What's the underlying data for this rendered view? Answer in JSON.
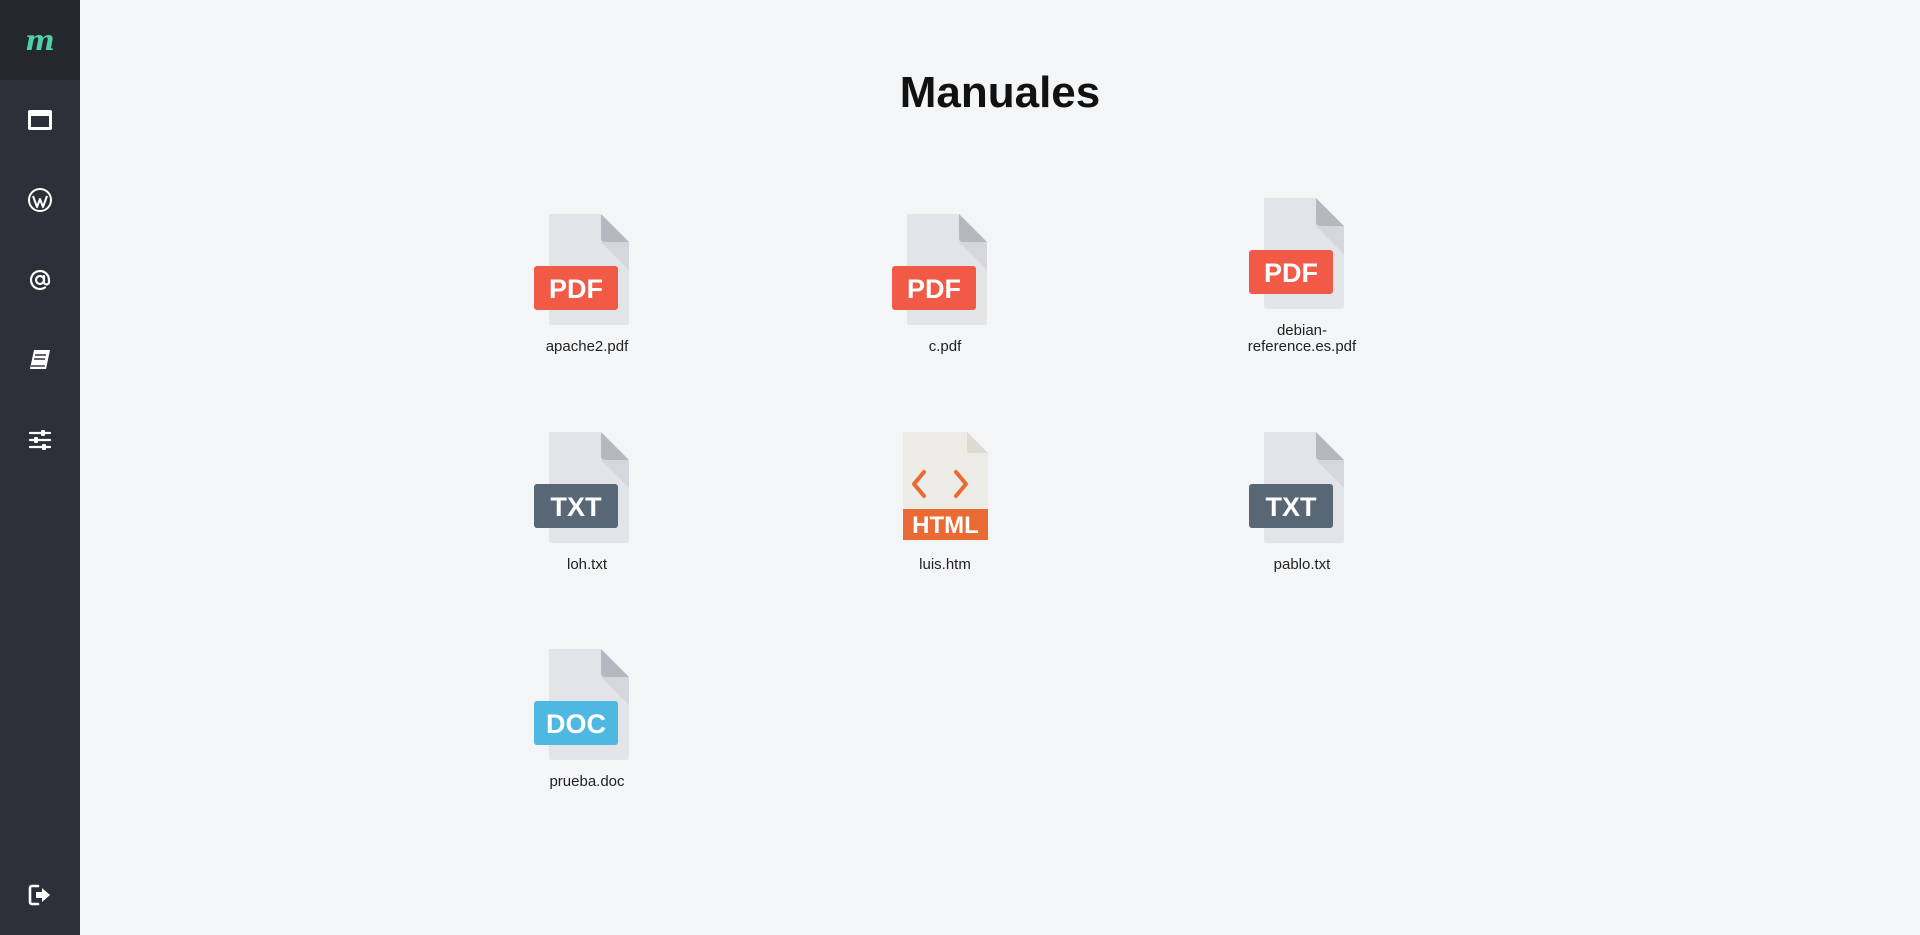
{
  "sidebar": {
    "logo": "m",
    "items": [
      {
        "icon": "browser-window-icon"
      },
      {
        "icon": "wordpress-icon"
      },
      {
        "icon": "at-sign-icon"
      },
      {
        "icon": "book-icon"
      },
      {
        "icon": "sliders-icon"
      }
    ],
    "logout_icon": "logout-icon"
  },
  "main": {
    "title": "Manuales",
    "files": [
      {
        "name": "apache2.pdf",
        "type": "PDF"
      },
      {
        "name": "c.pdf",
        "type": "PDF"
      },
      {
        "name": "debian-reference.es.pdf",
        "type": "PDF"
      },
      {
        "name": "loh.txt",
        "type": "TXT"
      },
      {
        "name": "luis.htm",
        "type": "HTML"
      },
      {
        "name": "pablo.txt",
        "type": "TXT"
      },
      {
        "name": "prueba.doc",
        "type": "DOC"
      }
    ]
  },
  "colors": {
    "pdf": "#f05a47",
    "txt": "#576776",
    "doc": "#4eb7e2",
    "html": "#ea6a33",
    "accent": "#4fd1a6"
  }
}
